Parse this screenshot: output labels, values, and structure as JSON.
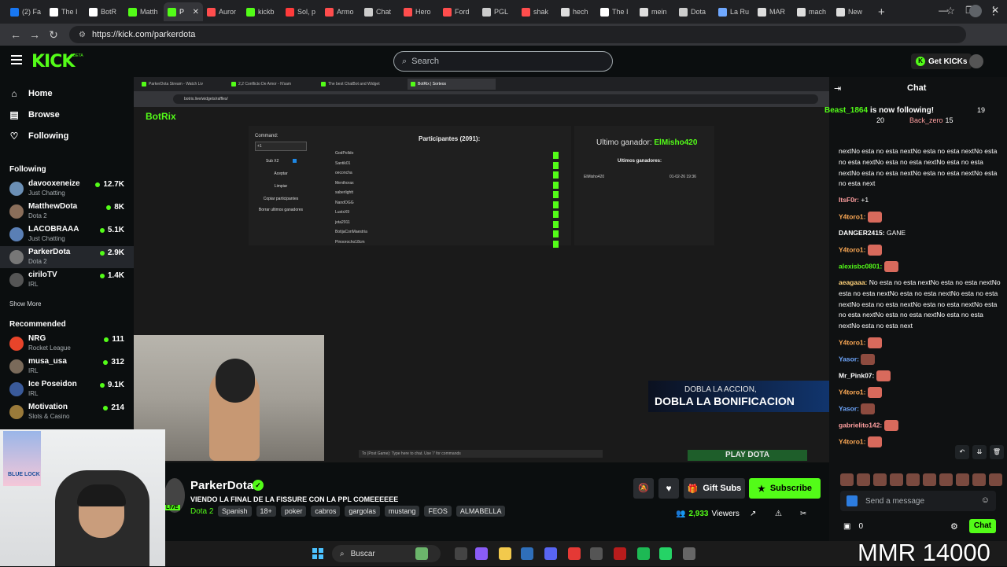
{
  "browser": {
    "tabs": [
      {
        "label": "(2) Fa",
        "color": "#1877f2"
      },
      {
        "label": "The I",
        "color": "#ffffff"
      },
      {
        "label": "BotR",
        "color": "#ffffff"
      },
      {
        "label": "Matth",
        "color": "#53fc18"
      },
      {
        "label": "P",
        "color": "#53fc18"
      },
      {
        "label": "Auror",
        "color": "#ff4d4d"
      },
      {
        "label": "kickb",
        "color": "#53fc18"
      },
      {
        "label": "Sol, p",
        "color": "#ff3b3b"
      },
      {
        "label": "Armo",
        "color": "#ff4d4d"
      },
      {
        "label": "Chat",
        "color": "#cccccc"
      },
      {
        "label": "Hero",
        "color": "#ff4d4d"
      },
      {
        "label": "Ford",
        "color": "#ff4d4d"
      },
      {
        "label": "PGL",
        "color": "#cccccc"
      },
      {
        "label": "shak",
        "color": "#ff4d4d"
      },
      {
        "label": "hech",
        "color": "#dddddd"
      },
      {
        "label": "The I",
        "color": "#ffffff"
      },
      {
        "label": "mein",
        "color": "#dddddd"
      },
      {
        "label": "Dota",
        "color": "#cccccc"
      },
      {
        "label": "La Ru",
        "color": "#6fa8ff"
      },
      {
        "label": "MAR",
        "color": "#dddddd"
      },
      {
        "label": "mach",
        "color": "#dddddd"
      },
      {
        "label": "New",
        "color": "#dddddd"
      }
    ],
    "url": "https://kick.com/parkerdota"
  },
  "header": {
    "logo": "KICK",
    "beta": "BETA",
    "search_placeholder": "Search",
    "get_kicks": "Get KICKs"
  },
  "sidebar": {
    "nav": [
      {
        "label": "Home",
        "icon": "home-icon",
        "glyph": "⌂"
      },
      {
        "label": "Browse",
        "icon": "browse-icon",
        "glyph": "▤"
      },
      {
        "label": "Following",
        "icon": "heart-icon",
        "glyph": "♡"
      }
    ],
    "following_title": "Following",
    "following": [
      {
        "name": "davooxeneize",
        "sub": "Just Chatting",
        "count": "12.7K",
        "color": "#6b8fb5"
      },
      {
        "name": "MatthewDota",
        "sub": "Dota 2",
        "count": "8K",
        "color": "#8a6e5a"
      },
      {
        "name": "LACOBRAAA",
        "sub": "Just Chatting",
        "count": "5.1K",
        "color": "#5a7fb5"
      },
      {
        "name": "ParkerDota",
        "sub": "Dota 2",
        "count": "2.9K",
        "color": "#777777"
      },
      {
        "name": "ciriloTV",
        "sub": "IRL",
        "count": "1.4K",
        "color": "#555555"
      }
    ],
    "show_more": "Show More",
    "recommended_title": "Recommended",
    "recommended": [
      {
        "name": "NRG",
        "sub": "Rocket League",
        "count": "111",
        "color": "#e8442a"
      },
      {
        "name": "musa_usa",
        "sub": "IRL",
        "count": "312",
        "color": "#7a6a5a"
      },
      {
        "name": "Ice Poseidon",
        "sub": "IRL",
        "count": "9.1K",
        "color": "#3a5a9a"
      },
      {
        "name": "Motivation",
        "sub": "Slots & Casino",
        "count": "214",
        "color": "#9a7a3a"
      }
    ]
  },
  "stream": {
    "inner_tabs": [
      "ParkerDota Stream - Watch Liv",
      "2,2 Conflicto De Amor - N'sam",
      "The best ChatBot and Widget",
      "BotRix | Sorteos"
    ],
    "inner_url": "botrix.live/widgets/raffles/",
    "botrix_logo": "BotRix",
    "command_label": "Command:",
    "command_value": "+1",
    "sub_label": "Sub X2",
    "buttons": [
      "Aceptar",
      "Limpiar",
      "Copiar participantes",
      "Borrar ultimos ganadores"
    ],
    "participants_title": "Participantes (2091):",
    "participants": [
      "GodPolldo",
      "Santik01",
      "oeconcha",
      "Menthorax",
      "saberlightt",
      "NandOGG",
      "LustxX9",
      "jota2911",
      "BotijaConMaestria",
      "Pinoorocho18cm"
    ],
    "last_winner_label": "Ultimo ganador:",
    "last_winner": "ElMisho420",
    "winners_title": "Ultimos ganadores:",
    "winner_entry": "ElMisho420",
    "winner_date": "01-02-26 19:36",
    "promo_line1": "DOBLA LA ACCION,",
    "promo_line2": "DOBLA LA BONIFICACION",
    "chat_hint": "To (Post Game): Type here to chat. Use '/' for commands",
    "play_dota": "PLAY DOTA"
  },
  "info": {
    "streamer": "ParkerDota",
    "live": "LIVE",
    "title": "VIENDO LA FINAL DE LA FISSURE CON LA PPL COMEEEEEE",
    "category": "Dota 2",
    "tags": [
      "Spanish",
      "18+",
      "poker",
      "cabros",
      "gargolas",
      "mustang",
      "FEOS",
      "ALMABELLA"
    ],
    "gift_subs": "Gift Subs",
    "subscribe": "Subscribe",
    "viewers_count": "2,933",
    "viewers_label": "Viewers"
  },
  "chat": {
    "title": "Chat",
    "banner_user": "Beast_1864",
    "banner_text": "is now following!",
    "gift1_count": "19",
    "gift2_count": "20",
    "gift2_user": "Back_zero",
    "gift2_extra": "15",
    "messages": [
      {
        "user": "",
        "color": "#ffffff",
        "text": "nextNo esta no esta nextNo esta no esta nextNo esta no esta nextNo esta no esta nextNo esta no esta nextNo esta no esta nextNo esta no esta nextNo esta no esta next",
        "emote": false
      },
      {
        "user": "ItsF0r:",
        "color": "#ff9f9f",
        "text": "+1",
        "emote": false
      },
      {
        "user": "Y4toro1:",
        "color": "#ffaa55",
        "text": "",
        "emote": true
      },
      {
        "user": "DANGER2415:",
        "color": "#ffffff",
        "text": "GANE",
        "emote": false
      },
      {
        "user": "Y4toro1:",
        "color": "#ffaa55",
        "text": "",
        "emote": true
      },
      {
        "user": "alexisbc0801:",
        "color": "#53fc18",
        "text": "",
        "emote": true
      },
      {
        "user": "aeagaaa:",
        "color": "#ffd27a",
        "text": "No esta no esta nextNo esta no esta nextNo esta no esta nextNo esta no esta nextNo esta no esta nextNo esta no esta nextNo esta no esta nextNo esta no esta nextNo esta no esta nextNo esta no esta nextNo esta no esta next",
        "emote": false
      },
      {
        "user": "Y4toro1:",
        "color": "#ffaa55",
        "text": "",
        "emote": true
      },
      {
        "user": "Yasor:",
        "color": "#6fa8ff",
        "text": "",
        "emote": true
      },
      {
        "user": "Mr_Pink07:",
        "color": "#ffffff",
        "text": "",
        "emote": true
      },
      {
        "user": "Y4toro1:",
        "color": "#ffaa55",
        "text": "",
        "emote": true
      },
      {
        "user": "Yasor:",
        "color": "#6fa8ff",
        "text": "",
        "emote": true
      },
      {
        "user": "gabrielito142:",
        "color": "#ff9f9f",
        "text": "",
        "emote": true
      },
      {
        "user": "Y4toro1:",
        "color": "#ffaa55",
        "text": "",
        "emote": true
      }
    ],
    "send_placeholder": "Send a message",
    "kicks_count": "0",
    "send_label": "Chat"
  },
  "overlay": {
    "poster_text": "BLUE LOCK",
    "mmr": "MMR 14000"
  },
  "taskbar": {
    "search": "Buscar"
  }
}
